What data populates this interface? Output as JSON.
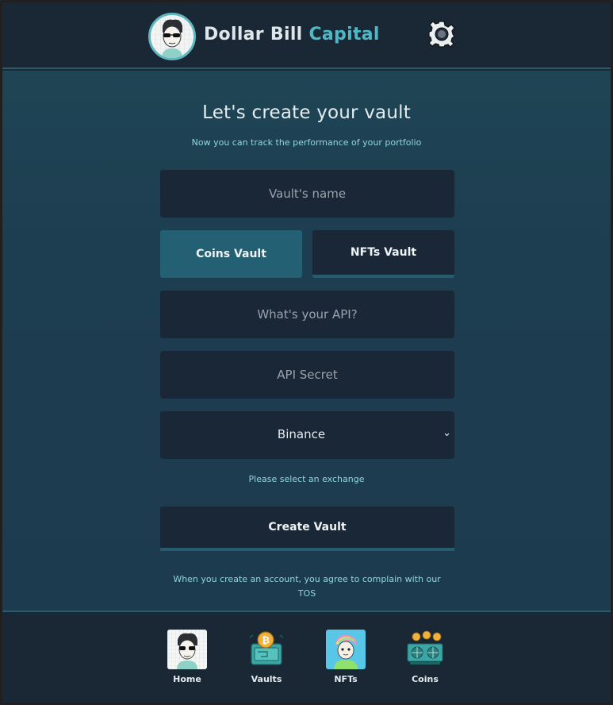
{
  "header": {
    "brand_part1": "Dollar Bill ",
    "brand_part2": "Capital",
    "logo_icon": "avatar-sunglasses-icon",
    "settings_icon": "gear-icon"
  },
  "main": {
    "title": "Let's create your vault",
    "subtitle": "Now you can track the performance of your portfolio",
    "vault_name_placeholder": "Vault's name",
    "vault_types": [
      "Coins Vault",
      "NFTs Vault"
    ],
    "selected_vault_type": "Coins Vault",
    "api_placeholder": "What's your API?",
    "api_secret_placeholder": "API Secret",
    "exchange_selected": "Binance",
    "exchange_hint": "Please select an exchange",
    "create_label": "Create Vault",
    "tos_text": "When you create an account, you agree to complain with our TOS"
  },
  "nav": {
    "items": [
      {
        "label": "Home",
        "icon": "avatar-icon"
      },
      {
        "label": "Vaults",
        "icon": "vault-bitcoin-icon"
      },
      {
        "label": "NFTs",
        "icon": "nft-avatar-icon"
      },
      {
        "label": "Coins",
        "icon": "mining-rig-icon"
      }
    ]
  },
  "colors": {
    "accent": "#4fb8c6",
    "active_toggle": "#246074",
    "panel": "#1a2737",
    "hint_text": "#8fd6de"
  }
}
